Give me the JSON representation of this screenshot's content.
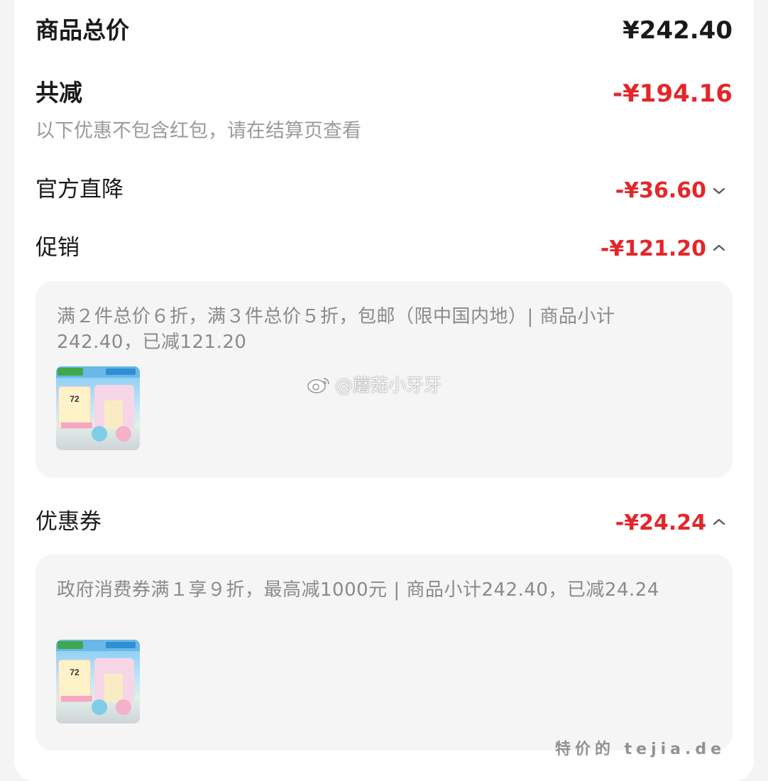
{
  "summary": {
    "total_label": "商品总价",
    "total_amount": "¥242.40",
    "discount_label": "共减",
    "discount_amount": "-¥194.16",
    "note": "以下优惠不包含红包，请在结算页查看"
  },
  "rows": {
    "official": {
      "label": "官方直降",
      "amount": "-¥36.60",
      "expanded": false
    },
    "promo": {
      "label": "促销",
      "amount": "-¥121.20",
      "expanded": true
    },
    "coupon": {
      "label": "优惠券",
      "amount": "-¥24.24",
      "expanded": true
    }
  },
  "panels": {
    "promo": {
      "text": "满２件总价６折，满３件总价５折，包邮（限中国内地）| 商品小计242.40，已减121.20",
      "thumb_price": "72"
    },
    "coupon": {
      "text": "政府消费券满１享９折，最高减1000元 | 商品小计242.40，已减24.24",
      "thumb_price": "72"
    }
  },
  "watermarks": {
    "weibo": "@蘑菇小牙牙",
    "site": "特价的 tejia.de"
  },
  "colors": {
    "accent_red": "#e4262a",
    "text_dark": "#1a1a1a",
    "text_muted": "#9a9a9a",
    "panel_bg": "#f5f5f5"
  },
  "icons": {
    "collapsed": "chevron-down-icon",
    "expanded": "chevron-up-icon"
  }
}
